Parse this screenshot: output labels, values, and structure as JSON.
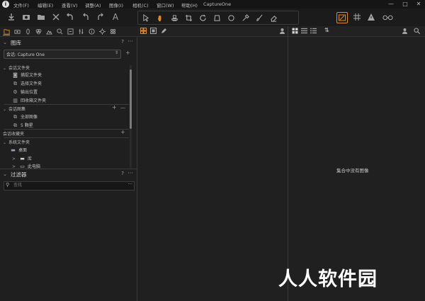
{
  "app": {
    "title": "CaptureOne"
  },
  "menubar": {
    "items": [
      "文件(F)",
      "编辑(E)",
      "查看(V)",
      "调整(A)",
      "图像(I)",
      "相机(C)",
      "窗口(W)",
      "帮助(H)"
    ],
    "window_controls": [
      "—",
      "□",
      "✕"
    ]
  },
  "toolbar": {
    "icons": [
      "import-icon",
      "camera-icon",
      "folder-icon",
      "delete-icon",
      "undo-all-icon",
      "undo-icon",
      "redo-icon",
      "text-icon"
    ],
    "cursor_tools": [
      "select-cursor-icon",
      "pan-cursor-icon",
      "stamp-cursor-icon",
      "crop-cursor-icon",
      "rotate-cursor-icon",
      "keystone-cursor-icon",
      "spot-cursor-icon",
      "picker-cursor-icon",
      "brush-cursor-icon",
      "erase-cursor-icon"
    ],
    "right_icons": [
      "exposure-warning-icon",
      "grid-icon",
      "warning-icon",
      "glasses-icon"
    ],
    "accent": "#e58a1f"
  },
  "left_panel": {
    "library": {
      "title": "图库",
      "help": "?",
      "more": "···",
      "session_select": "会话: Capture One",
      "session_folders": {
        "title": "会话文件夹",
        "items": [
          {
            "icon": "capture-folder-icon",
            "label": "捕捉文件夹"
          },
          {
            "icon": "select-folder-icon",
            "label": "选择文件夹"
          },
          {
            "icon": "output-icon",
            "label": "输出位置"
          },
          {
            "icon": "trash-icon",
            "label": "回收箱文件夹"
          }
        ]
      },
      "session_albums": {
        "title": "会话图集",
        "add": "+",
        "remove": "—",
        "items": [
          {
            "icon": "all-images-icon",
            "label": "全部图像"
          },
          {
            "icon": "stars-icon",
            "label": "5 颗星"
          }
        ]
      },
      "session_favorites": {
        "title": "会话收藏夹",
        "add": "+"
      },
      "system_folders": {
        "title": "系统文件夹",
        "items": [
          {
            "icon": "desktop-icon",
            "label": "桌面",
            "expand": ""
          },
          {
            "icon": "library-icon",
            "label": "库",
            "expand": ">"
          },
          {
            "icon": "computer-icon",
            "label": "此电脑",
            "expand": ">"
          }
        ]
      }
    },
    "filters": {
      "title": "过滤器",
      "help": "?",
      "more": "···",
      "search_placeholder": "查找"
    }
  },
  "viewer": {
    "empty_message": "集合中没有图像"
  },
  "watermark": "人人软件园"
}
